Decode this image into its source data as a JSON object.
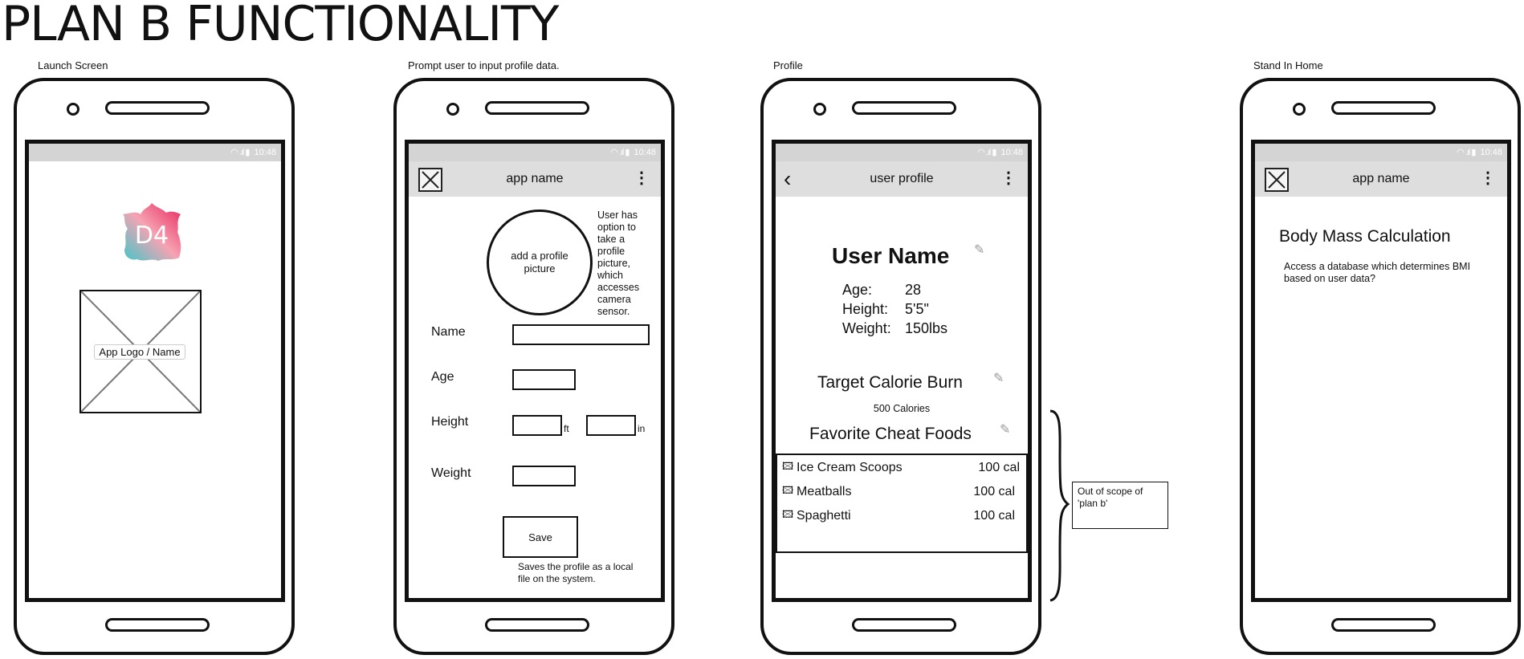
{
  "page_title": "PLAN B FUNCTIONALITY",
  "status_time": "10:48",
  "screens": {
    "launch": {
      "label": "Launch Screen",
      "logo_text": "D4",
      "placeholder_label": "App Logo / Name"
    },
    "prompt": {
      "label": "Prompt user to input profile data.",
      "app_title": "app name",
      "profile_pic_label": "add a profile picture",
      "camera_note": "User has option to take a profile picture, which accesses camera sensor.",
      "fields": {
        "name_label": "Name",
        "age_label": "Age",
        "height_label": "Height",
        "height_ft_unit": "ft",
        "height_in_unit": "in",
        "weight_label": "Weight"
      },
      "save_label": "Save",
      "save_note": "Saves the profile as a local file on the system."
    },
    "profile": {
      "label": "Profile",
      "app_title": "user profile",
      "user_name": "User Name",
      "stats": [
        {
          "label": "Age:",
          "value": "28"
        },
        {
          "label": "Height:",
          "value": "5'5\""
        },
        {
          "label": "Weight:",
          "value": "150lbs"
        }
      ],
      "target_title": "Target Calorie Burn",
      "target_value": "500 Calories",
      "cheat_title": "Favorite Cheat Foods",
      "foods": [
        {
          "name": "Ice Cream Scoops",
          "cal": "100 cal"
        },
        {
          "name": "Meatballs",
          "cal": "100 cal"
        },
        {
          "name": "Spaghetti",
          "cal": "100 cal"
        }
      ],
      "out_of_scope_note": "Out of scope of 'plan b'"
    },
    "standin": {
      "label": "Stand In Home",
      "app_title": "app name",
      "heading": "Body Mass Calculation",
      "description": "Access a database which determines BMI based on user data?"
    }
  }
}
